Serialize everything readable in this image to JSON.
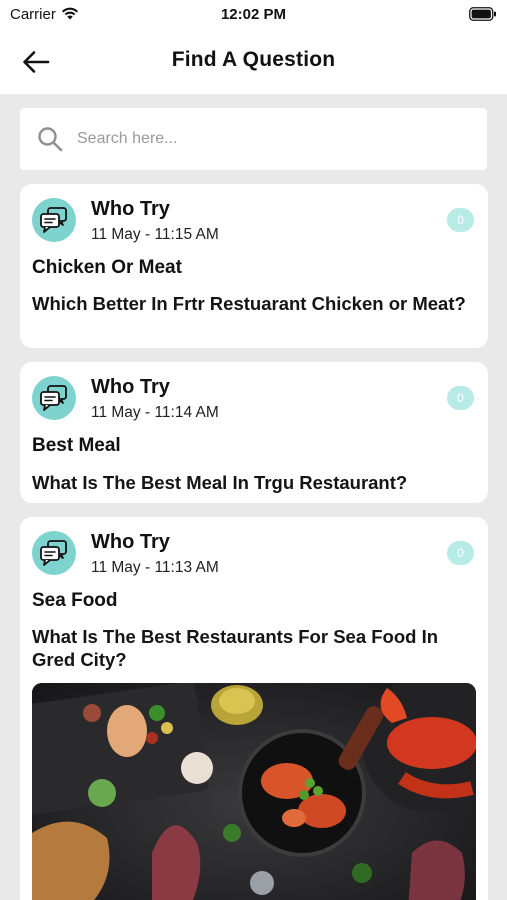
{
  "status_bar": {
    "carrier": "Carrier",
    "time": "12:02 PM"
  },
  "nav": {
    "title": "Find A Question",
    "back_icon": "arrow-left-icon"
  },
  "search": {
    "placeholder": "Search here...",
    "value": "",
    "icon": "search-icon"
  },
  "posts": [
    {
      "author": "Who Try",
      "date": "11 May - 11:15 AM",
      "answers": "0",
      "title": "Chicken Or Meat",
      "question": "Which Better In Frtr Restuarant Chicken or Meat?"
    },
    {
      "author": "Who Try",
      "date": "11 May - 11:14 AM",
      "answers": "0",
      "title": "Best Meal",
      "question": "What Is The Best Meal In Trgu Restaurant?"
    },
    {
      "author": "Who Try",
      "date": "11 May - 11:13 AM",
      "answers": "0",
      "title": "Sea Food",
      "question": "What Is The Best Restaurants For Sea Food In Gred City?",
      "image": "seafood-dishes-photo"
    }
  ],
  "colors": {
    "accent": "#7fd3cf",
    "badge": "#b7ebe6",
    "background": "#e9e9e9"
  }
}
